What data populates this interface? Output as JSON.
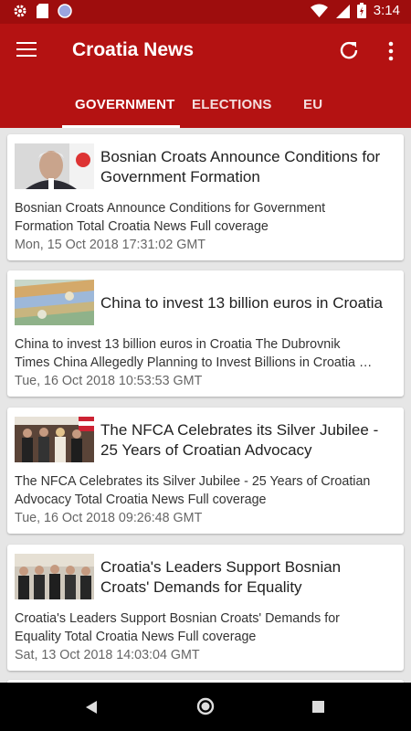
{
  "status_bar": {
    "time": "3:14"
  },
  "app": {
    "title": "Croatia News"
  },
  "tabs": [
    {
      "label": "GOVERNMENT",
      "selected": true
    },
    {
      "label": "ELECTIONS",
      "selected": false
    },
    {
      "label": "EU",
      "selected": false
    }
  ],
  "articles": [
    {
      "headline_line1": "Bosnian Croats Announce Conditions for",
      "headline_line2": "Government Formation",
      "summary_line1": "Bosnian Croats Announce Conditions for Government",
      "summary_line2": "Formation  Total Croatia News  Full coverage",
      "date": "Mon, 15 Oct 2018 17:31:02 GMT"
    },
    {
      "headline_line1": "China to invest 13 billion euros in Croatia",
      "headline_line2": "",
      "summary_line1": "China to invest 13 billion euros in Croatia  The Dubrovnik",
      "summary_line2": "Times  China Allegedly Planning to Invest Billions in Croatia …",
      "date": "Tue, 16 Oct 2018 10:53:53 GMT"
    },
    {
      "headline_line1": "The NFCA Celebrates its Silver Jubilee -",
      "headline_line2": "25 Years of Croatian Advocacy",
      "summary_line1": "The NFCA Celebrates its Silver Jubilee - 25 Years of Croatian",
      "summary_line2": "Advocacy  Total Croatia News  Full coverage",
      "date": "Tue, 16 Oct 2018 09:26:48 GMT"
    },
    {
      "headline_line1": "Croatia's Leaders Support Bosnian",
      "headline_line2": "Croats' Demands for Equality",
      "summary_line1": "Croatia's Leaders Support Bosnian Croats' Demands for",
      "summary_line2": "Equality  Total Croatia News  Full coverage",
      "date": "Sat, 13 Oct 2018 14:03:04 GMT"
    }
  ],
  "colors": {
    "status_bar": "#9e0d0d",
    "app_bar": "#b41212",
    "background": "#e6e6e6"
  }
}
